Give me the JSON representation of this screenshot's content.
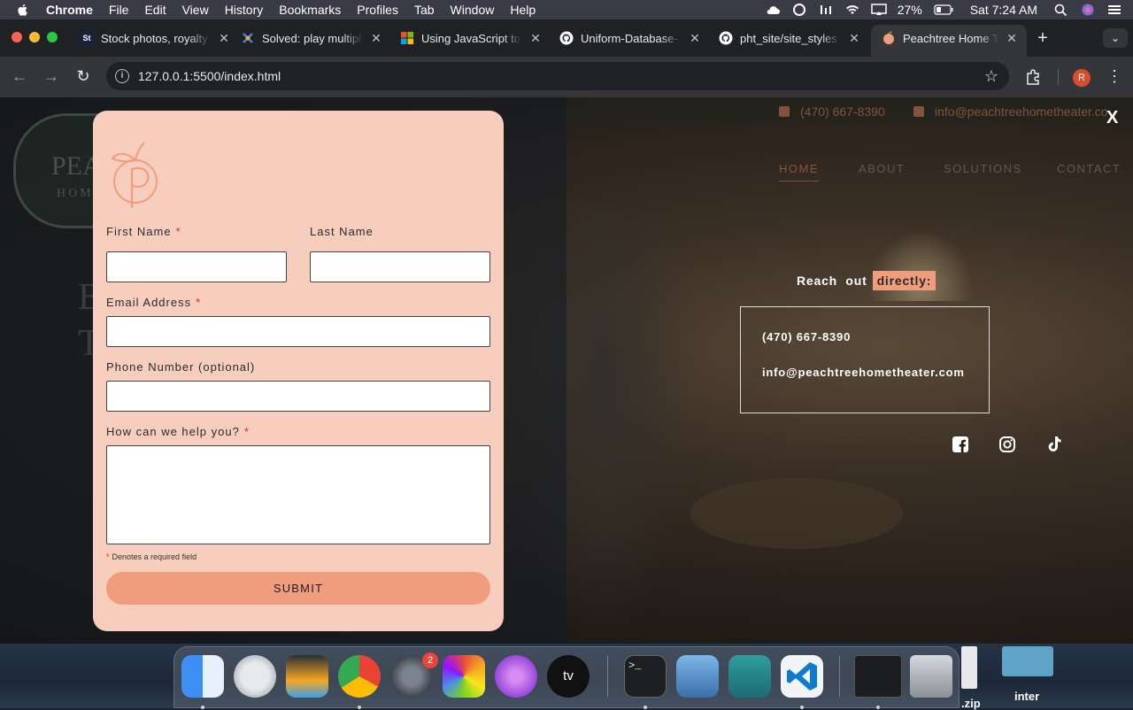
{
  "menubar": {
    "app": "Chrome",
    "menus": [
      "File",
      "Edit",
      "View",
      "History",
      "Bookmarks",
      "Profiles",
      "Tab",
      "Window",
      "Help"
    ],
    "battery": "27%",
    "clock": "Sat 7:24 AM"
  },
  "browser": {
    "tabs": [
      {
        "title": "Stock photos, royalty-free images",
        "favicon": "St"
      },
      {
        "title": "Solved: play multiple",
        "favicon": ""
      },
      {
        "title": "Using JavaScript to",
        "favicon": ""
      },
      {
        "title": "Uniform-Database-",
        "favicon": ""
      },
      {
        "title": "pht_site/site_styles",
        "favicon": ""
      },
      {
        "title": "Peachtree Home Theater",
        "favicon": ""
      }
    ],
    "url": "127.0.0.1:5500/index.html",
    "profile_initial": "R"
  },
  "site": {
    "phone": "(470) 667-8390",
    "email_header": "info@peachtreehometheater.co",
    "nav": [
      "HOME",
      "ABOUT",
      "SOLUTIONS",
      "CONTACT"
    ],
    "bg_logo_line1": "PEAC",
    "bg_logo_line2": "HOM",
    "bg_line1": "B",
    "bg_line2": "T"
  },
  "contact_panel": {
    "close": "X",
    "reach_prefix": "Reach  out",
    "reach_highlight": "directly:",
    "phone": "(470) 667-8390",
    "email": "info@peachtreehometheater.com"
  },
  "form": {
    "first_name": {
      "label": "First Name",
      "value": ""
    },
    "last_name": {
      "label": "Last Name",
      "value": ""
    },
    "email": {
      "label": "Email Address",
      "value": ""
    },
    "phone": {
      "label": "Phone Number (optional)",
      "value": ""
    },
    "message": {
      "label": "How can we help you?",
      "value": ""
    },
    "required_mark": "*",
    "required_note": "Denotes a required field",
    "submit": "SUBMIT"
  },
  "dock": {
    "settings_badge": "2",
    "labels": [
      ".zip",
      "inter"
    ]
  },
  "colors": {
    "peach_panel": "#f7cebe",
    "peach_accent": "#f09d7d",
    "required": "#d9232e"
  }
}
